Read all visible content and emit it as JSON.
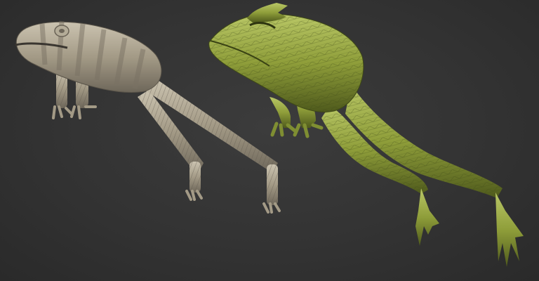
{
  "viewport": {
    "background_color": "#343434"
  },
  "models": [
    {
      "id": "zsphere-frog",
      "material_color": "#a39a86",
      "shadow_color": "#6e675a",
      "highlight_color": "#cbc3b0"
    },
    {
      "id": "sculpted-frog",
      "material_color": "#8f9e3a",
      "shadow_color": "#4f5a1c",
      "highlight_color": "#b9c766"
    }
  ]
}
